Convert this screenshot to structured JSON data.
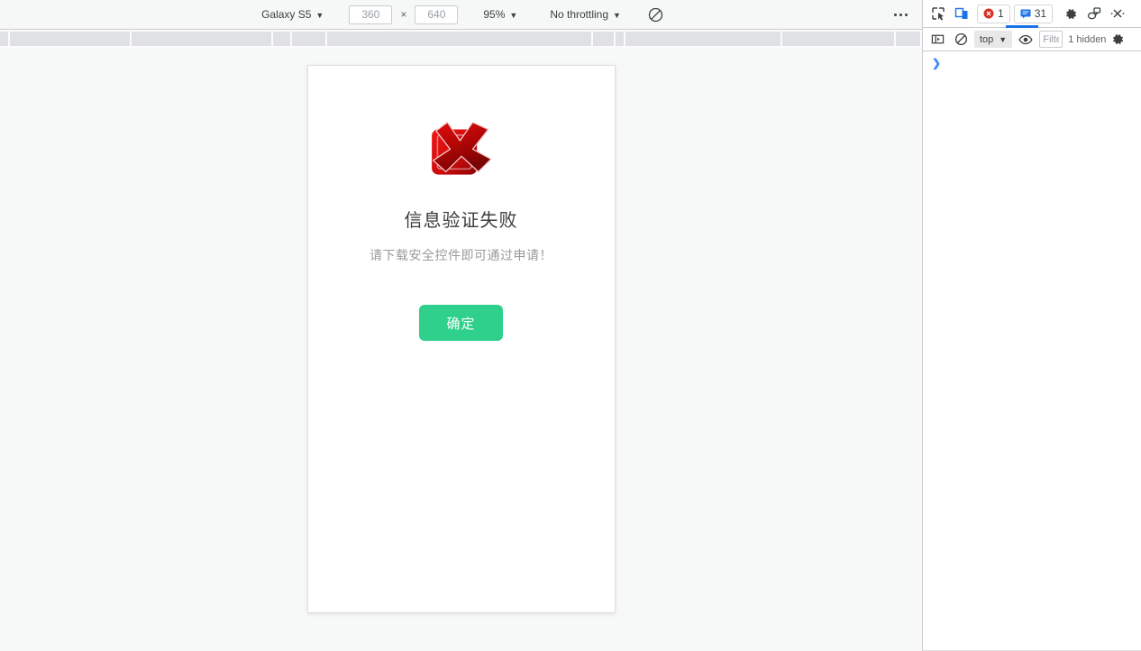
{
  "device_toolbar": {
    "device_label": "Galaxy S5",
    "width_value": "360",
    "height_value": "640",
    "dimension_separator": "×",
    "zoom_label": "95%",
    "throttling_label": "No throttling",
    "rotate_icon": "rotate-device-icon",
    "more_options_icon": "more-options-icon"
  },
  "page": {
    "error_icon": "red-error-cross-icon",
    "title": "信息验证失败",
    "subtitle": "请下载安全控件即可通过申请！",
    "confirm_button": "确定"
  },
  "devtools": {
    "inspect_icon": "inspect-element-icon",
    "device_toggle_icon": "device-toolbar-icon",
    "error_count": "1",
    "message_count": "31",
    "settings_icon": "gear-icon",
    "more_tools_icon": "customize-devtools-icon",
    "close_icon": "close-icon",
    "console": {
      "sidebar_icon": "console-sidebar-icon",
      "clear_icon": "clear-console-icon",
      "context_label": "top",
      "eye_icon": "live-expression-eye-icon",
      "filter_placeholder": "Filter",
      "hidden_label": "1 hidden",
      "settings_icon": "console-settings-gear-icon",
      "prompt_caret": "❯",
      "prompt_value": ""
    }
  },
  "colors": {
    "accent_green": "#2fd08b",
    "error_red": "#d91b1b",
    "devtools_blue": "#1a73e8"
  }
}
